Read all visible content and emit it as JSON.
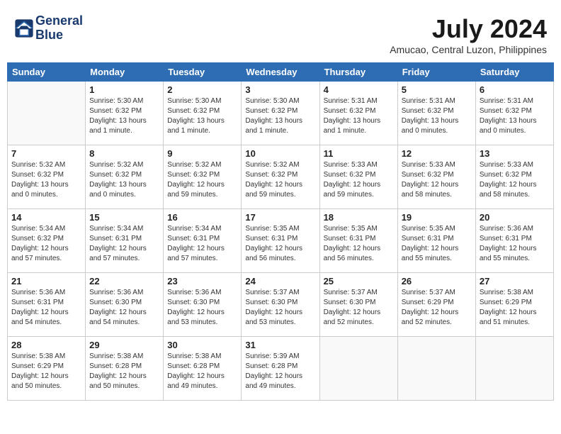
{
  "header": {
    "logo_line1": "General",
    "logo_line2": "Blue",
    "month_title": "July 2024",
    "location": "Amucao, Central Luzon, Philippines"
  },
  "days_of_week": [
    "Sunday",
    "Monday",
    "Tuesday",
    "Wednesday",
    "Thursday",
    "Friday",
    "Saturday"
  ],
  "weeks": [
    [
      {
        "day": "",
        "info": ""
      },
      {
        "day": "1",
        "info": "Sunrise: 5:30 AM\nSunset: 6:32 PM\nDaylight: 13 hours\nand 1 minute."
      },
      {
        "day": "2",
        "info": "Sunrise: 5:30 AM\nSunset: 6:32 PM\nDaylight: 13 hours\nand 1 minute."
      },
      {
        "day": "3",
        "info": "Sunrise: 5:30 AM\nSunset: 6:32 PM\nDaylight: 13 hours\nand 1 minute."
      },
      {
        "day": "4",
        "info": "Sunrise: 5:31 AM\nSunset: 6:32 PM\nDaylight: 13 hours\nand 1 minute."
      },
      {
        "day": "5",
        "info": "Sunrise: 5:31 AM\nSunset: 6:32 PM\nDaylight: 13 hours\nand 0 minutes."
      },
      {
        "day": "6",
        "info": "Sunrise: 5:31 AM\nSunset: 6:32 PM\nDaylight: 13 hours\nand 0 minutes."
      }
    ],
    [
      {
        "day": "7",
        "info": "Sunrise: 5:32 AM\nSunset: 6:32 PM\nDaylight: 13 hours\nand 0 minutes."
      },
      {
        "day": "8",
        "info": "Sunrise: 5:32 AM\nSunset: 6:32 PM\nDaylight: 13 hours\nand 0 minutes."
      },
      {
        "day": "9",
        "info": "Sunrise: 5:32 AM\nSunset: 6:32 PM\nDaylight: 12 hours\nand 59 minutes."
      },
      {
        "day": "10",
        "info": "Sunrise: 5:32 AM\nSunset: 6:32 PM\nDaylight: 12 hours\nand 59 minutes."
      },
      {
        "day": "11",
        "info": "Sunrise: 5:33 AM\nSunset: 6:32 PM\nDaylight: 12 hours\nand 59 minutes."
      },
      {
        "day": "12",
        "info": "Sunrise: 5:33 AM\nSunset: 6:32 PM\nDaylight: 12 hours\nand 58 minutes."
      },
      {
        "day": "13",
        "info": "Sunrise: 5:33 AM\nSunset: 6:32 PM\nDaylight: 12 hours\nand 58 minutes."
      }
    ],
    [
      {
        "day": "14",
        "info": "Sunrise: 5:34 AM\nSunset: 6:32 PM\nDaylight: 12 hours\nand 57 minutes."
      },
      {
        "day": "15",
        "info": "Sunrise: 5:34 AM\nSunset: 6:31 PM\nDaylight: 12 hours\nand 57 minutes."
      },
      {
        "day": "16",
        "info": "Sunrise: 5:34 AM\nSunset: 6:31 PM\nDaylight: 12 hours\nand 57 minutes."
      },
      {
        "day": "17",
        "info": "Sunrise: 5:35 AM\nSunset: 6:31 PM\nDaylight: 12 hours\nand 56 minutes."
      },
      {
        "day": "18",
        "info": "Sunrise: 5:35 AM\nSunset: 6:31 PM\nDaylight: 12 hours\nand 56 minutes."
      },
      {
        "day": "19",
        "info": "Sunrise: 5:35 AM\nSunset: 6:31 PM\nDaylight: 12 hours\nand 55 minutes."
      },
      {
        "day": "20",
        "info": "Sunrise: 5:36 AM\nSunset: 6:31 PM\nDaylight: 12 hours\nand 55 minutes."
      }
    ],
    [
      {
        "day": "21",
        "info": "Sunrise: 5:36 AM\nSunset: 6:31 PM\nDaylight: 12 hours\nand 54 minutes."
      },
      {
        "day": "22",
        "info": "Sunrise: 5:36 AM\nSunset: 6:30 PM\nDaylight: 12 hours\nand 54 minutes."
      },
      {
        "day": "23",
        "info": "Sunrise: 5:36 AM\nSunset: 6:30 PM\nDaylight: 12 hours\nand 53 minutes."
      },
      {
        "day": "24",
        "info": "Sunrise: 5:37 AM\nSunset: 6:30 PM\nDaylight: 12 hours\nand 53 minutes."
      },
      {
        "day": "25",
        "info": "Sunrise: 5:37 AM\nSunset: 6:30 PM\nDaylight: 12 hours\nand 52 minutes."
      },
      {
        "day": "26",
        "info": "Sunrise: 5:37 AM\nSunset: 6:29 PM\nDaylight: 12 hours\nand 52 minutes."
      },
      {
        "day": "27",
        "info": "Sunrise: 5:38 AM\nSunset: 6:29 PM\nDaylight: 12 hours\nand 51 minutes."
      }
    ],
    [
      {
        "day": "28",
        "info": "Sunrise: 5:38 AM\nSunset: 6:29 PM\nDaylight: 12 hours\nand 50 minutes."
      },
      {
        "day": "29",
        "info": "Sunrise: 5:38 AM\nSunset: 6:28 PM\nDaylight: 12 hours\nand 50 minutes."
      },
      {
        "day": "30",
        "info": "Sunrise: 5:38 AM\nSunset: 6:28 PM\nDaylight: 12 hours\nand 49 minutes."
      },
      {
        "day": "31",
        "info": "Sunrise: 5:39 AM\nSunset: 6:28 PM\nDaylight: 12 hours\nand 49 minutes."
      },
      {
        "day": "",
        "info": ""
      },
      {
        "day": "",
        "info": ""
      },
      {
        "day": "",
        "info": ""
      }
    ]
  ]
}
